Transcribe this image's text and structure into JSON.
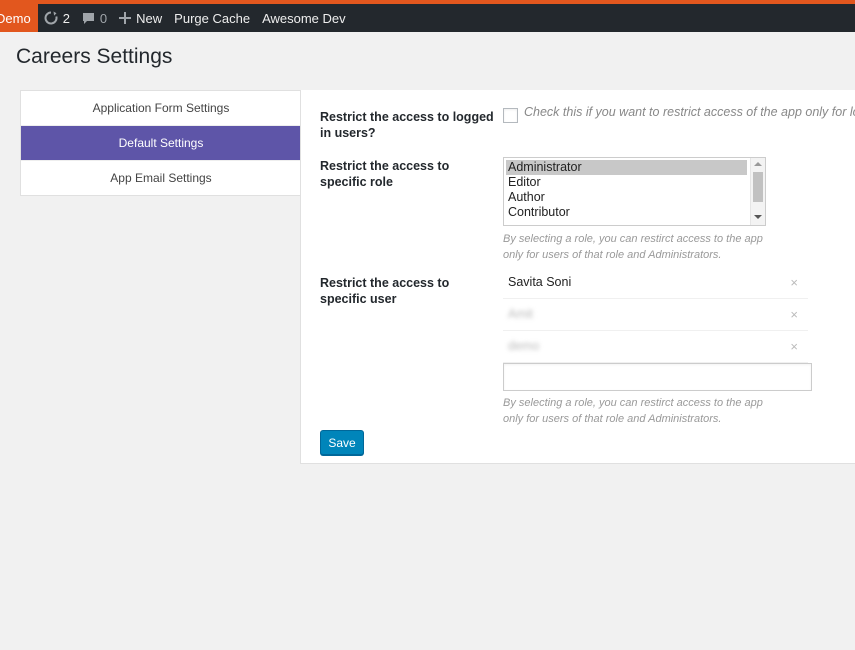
{
  "colors": {
    "admin_accent": "#e2571e",
    "admin_bar": "#23282d",
    "tab_active": "#5e55a8",
    "save_button": "#0085ba"
  },
  "admin_bar": {
    "site_label": "Demo",
    "updates_icon": "refresh-icon",
    "updates_count": "2",
    "comments_icon": "comment-icon",
    "comments_count": "0",
    "new_icon": "plus-icon",
    "new_label": "New",
    "purge_label": "Purge Cache",
    "theme_label": "Awesome Dev"
  },
  "page": {
    "title": "Careers Settings"
  },
  "tabs": [
    {
      "label": "Application Form Settings",
      "active": false
    },
    {
      "label": "Default Settings",
      "active": true
    },
    {
      "label": "App Email Settings",
      "active": false
    }
  ],
  "settings": {
    "logged_in": {
      "label": "Restrict the access to logged in users?",
      "checked": false,
      "description": "Check this if you want to restrict access of the app only for logg"
    },
    "role": {
      "label": "Restrict the access to specific role",
      "options": [
        "Administrator",
        "Editor",
        "Author",
        "Contributor"
      ],
      "selected": "Administrator",
      "help": "By selecting a role, you can restirct access to the app only for users of that role and Administrators."
    },
    "user": {
      "label": "Restrict the access to specific user",
      "users": [
        "Savita Soni",
        "Amit",
        "demo"
      ],
      "remove_glyph": "×",
      "input_value": "",
      "help": "By selecting a role, you can restirct access to the app only for users of that role and Administrators."
    }
  },
  "save_label": "Save"
}
